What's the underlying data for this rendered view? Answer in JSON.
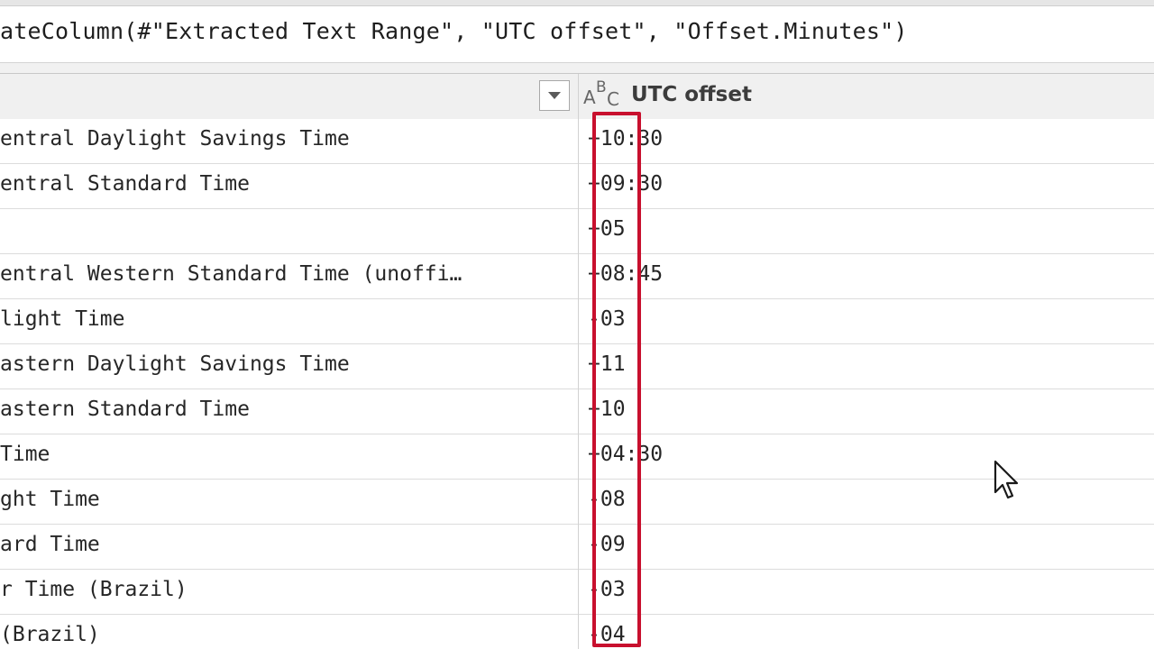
{
  "formula": {
    "text": "ateColumn(#\"Extracted Text Range\", \"UTC offset\", \"Offset.Minutes\")"
  },
  "column_header": {
    "type_icon": {
      "a": "A",
      "b": "B",
      "c": "C"
    },
    "title": "UTC offset"
  },
  "rows": [
    {
      "left": "entral Daylight Savings Time",
      "right": "+10:30"
    },
    {
      "left": "entral Standard Time",
      "right": "+09:30"
    },
    {
      "left": "",
      "right": "+05"
    },
    {
      "left": "entral Western Standard Time (unoffi…",
      "right": "+08:45"
    },
    {
      "left": "light Time",
      "right": "-03"
    },
    {
      "left": "astern Daylight Savings Time",
      "right": "+11"
    },
    {
      "left": "astern Standard Time",
      "right": "+10"
    },
    {
      "left": "Time",
      "right": "+04:30"
    },
    {
      "left": "ght Time",
      "right": "-08"
    },
    {
      "left": "ard Time",
      "right": "-09"
    },
    {
      "left": "r Time (Brazil)",
      "right": "-03"
    },
    {
      "left": "(Brazil)",
      "right": "-04"
    }
  ],
  "colors": {
    "highlight": "#c8102e",
    "header_bg": "#f0f0f0",
    "grid_line": "#dcdcdc"
  },
  "icons": {
    "filter": "chevron-down-icon",
    "type": "text-type-icon",
    "cursor": "mouse-pointer-icon"
  }
}
